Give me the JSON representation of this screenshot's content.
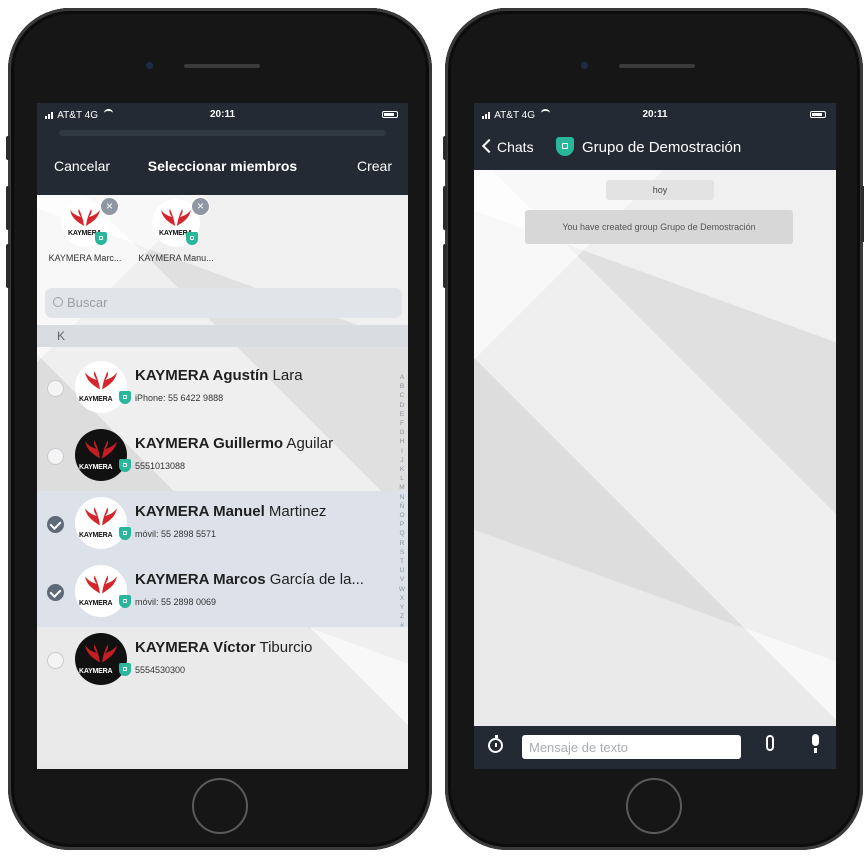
{
  "left_screen": {
    "status": {
      "carrier": "AT&T 4G",
      "time": "20:11"
    },
    "nav": {
      "cancel": "Cancelar",
      "title": "Seleccionar miembros",
      "create": "Crear"
    },
    "selected_members": [
      {
        "name": "KAYMERA Marc...",
        "brand": "KAYMERA"
      },
      {
        "name": "KAYMERA Manu...",
        "brand": "KAYMERA"
      }
    ],
    "search": {
      "placeholder": "Buscar"
    },
    "section": "K",
    "contacts": [
      {
        "bold": "KAYMERA Agustín",
        "rest": " Lara",
        "sub": "iPhone: 55 6422 9888",
        "brand": "KAYMERA",
        "selected": false,
        "avatar": "light"
      },
      {
        "bold": "KAYMERA Guillermo",
        "rest": " Aguilar",
        "sub": "5551013088",
        "brand": "KAYMERA",
        "selected": false,
        "avatar": "dark"
      },
      {
        "bold": "KAYMERA Manuel",
        "rest": " Martinez",
        "sub": "móvil: 55 2898 5571",
        "brand": "KAYMERA",
        "selected": true,
        "avatar": "light"
      },
      {
        "bold": "KAYMERA Marcos",
        "rest": " García de la...",
        "sub": "móvil: 55 2898 0069",
        "brand": "KAYMERA",
        "selected": true,
        "avatar": "light"
      },
      {
        "bold": "KAYMERA Víctor",
        "rest": " Tiburcio",
        "sub": "5554530300",
        "brand": "KAYMERA",
        "selected": false,
        "avatar": "dark"
      }
    ],
    "alpha_index": [
      "A",
      "B",
      "C",
      "D",
      "E",
      "F",
      "G",
      "H",
      "I",
      "J",
      "K",
      "L",
      "M",
      "N",
      "Ñ",
      "O",
      "P",
      "Q",
      "R",
      "S",
      "T",
      "U",
      "V",
      "W",
      "X",
      "Y",
      "Z",
      "#"
    ]
  },
  "right_screen": {
    "status": {
      "carrier": "AT&T 4G",
      "time": "20:11"
    },
    "nav": {
      "back": "Chats",
      "title": "Grupo de Demostración"
    },
    "date_chip": "hoy",
    "system_message": "You have created group Grupo de Demostración",
    "input": {
      "placeholder": "Mensaje de texto"
    }
  },
  "colors": {
    "nav_bg": "#232a33",
    "shield": "#2ab69a",
    "wing_red": "#d4262b",
    "selected_row": "#dde2ea"
  },
  "icons": [
    "signal-icon",
    "wifi-icon",
    "battery-icon",
    "close-icon",
    "search-icon",
    "shield-icon",
    "check-icon",
    "chevron-left-icon",
    "timer-icon",
    "paperclip-icon",
    "microphone-icon"
  ]
}
